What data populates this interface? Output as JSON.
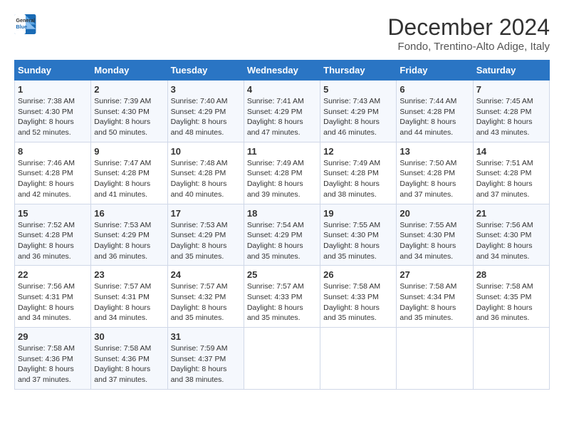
{
  "logo": {
    "line1": "General",
    "line2": "Blue"
  },
  "title": "December 2024",
  "location": "Fondo, Trentino-Alto Adige, Italy",
  "days_of_week": [
    "Sunday",
    "Monday",
    "Tuesday",
    "Wednesday",
    "Thursday",
    "Friday",
    "Saturday"
  ],
  "weeks": [
    [
      {
        "day": "1",
        "sunrise": "Sunrise: 7:38 AM",
        "sunset": "Sunset: 4:30 PM",
        "daylight": "Daylight: 8 hours and 52 minutes."
      },
      {
        "day": "2",
        "sunrise": "Sunrise: 7:39 AM",
        "sunset": "Sunset: 4:30 PM",
        "daylight": "Daylight: 8 hours and 50 minutes."
      },
      {
        "day": "3",
        "sunrise": "Sunrise: 7:40 AM",
        "sunset": "Sunset: 4:29 PM",
        "daylight": "Daylight: 8 hours and 48 minutes."
      },
      {
        "day": "4",
        "sunrise": "Sunrise: 7:41 AM",
        "sunset": "Sunset: 4:29 PM",
        "daylight": "Daylight: 8 hours and 47 minutes."
      },
      {
        "day": "5",
        "sunrise": "Sunrise: 7:43 AM",
        "sunset": "Sunset: 4:29 PM",
        "daylight": "Daylight: 8 hours and 46 minutes."
      },
      {
        "day": "6",
        "sunrise": "Sunrise: 7:44 AM",
        "sunset": "Sunset: 4:28 PM",
        "daylight": "Daylight: 8 hours and 44 minutes."
      },
      {
        "day": "7",
        "sunrise": "Sunrise: 7:45 AM",
        "sunset": "Sunset: 4:28 PM",
        "daylight": "Daylight: 8 hours and 43 minutes."
      }
    ],
    [
      {
        "day": "8",
        "sunrise": "Sunrise: 7:46 AM",
        "sunset": "Sunset: 4:28 PM",
        "daylight": "Daylight: 8 hours and 42 minutes."
      },
      {
        "day": "9",
        "sunrise": "Sunrise: 7:47 AM",
        "sunset": "Sunset: 4:28 PM",
        "daylight": "Daylight: 8 hours and 41 minutes."
      },
      {
        "day": "10",
        "sunrise": "Sunrise: 7:48 AM",
        "sunset": "Sunset: 4:28 PM",
        "daylight": "Daylight: 8 hours and 40 minutes."
      },
      {
        "day": "11",
        "sunrise": "Sunrise: 7:49 AM",
        "sunset": "Sunset: 4:28 PM",
        "daylight": "Daylight: 8 hours and 39 minutes."
      },
      {
        "day": "12",
        "sunrise": "Sunrise: 7:49 AM",
        "sunset": "Sunset: 4:28 PM",
        "daylight": "Daylight: 8 hours and 38 minutes."
      },
      {
        "day": "13",
        "sunrise": "Sunrise: 7:50 AM",
        "sunset": "Sunset: 4:28 PM",
        "daylight": "Daylight: 8 hours and 37 minutes."
      },
      {
        "day": "14",
        "sunrise": "Sunrise: 7:51 AM",
        "sunset": "Sunset: 4:28 PM",
        "daylight": "Daylight: 8 hours and 37 minutes."
      }
    ],
    [
      {
        "day": "15",
        "sunrise": "Sunrise: 7:52 AM",
        "sunset": "Sunset: 4:28 PM",
        "daylight": "Daylight: 8 hours and 36 minutes."
      },
      {
        "day": "16",
        "sunrise": "Sunrise: 7:53 AM",
        "sunset": "Sunset: 4:29 PM",
        "daylight": "Daylight: 8 hours and 36 minutes."
      },
      {
        "day": "17",
        "sunrise": "Sunrise: 7:53 AM",
        "sunset": "Sunset: 4:29 PM",
        "daylight": "Daylight: 8 hours and 35 minutes."
      },
      {
        "day": "18",
        "sunrise": "Sunrise: 7:54 AM",
        "sunset": "Sunset: 4:29 PM",
        "daylight": "Daylight: 8 hours and 35 minutes."
      },
      {
        "day": "19",
        "sunrise": "Sunrise: 7:55 AM",
        "sunset": "Sunset: 4:30 PM",
        "daylight": "Daylight: 8 hours and 35 minutes."
      },
      {
        "day": "20",
        "sunrise": "Sunrise: 7:55 AM",
        "sunset": "Sunset: 4:30 PM",
        "daylight": "Daylight: 8 hours and 34 minutes."
      },
      {
        "day": "21",
        "sunrise": "Sunrise: 7:56 AM",
        "sunset": "Sunset: 4:30 PM",
        "daylight": "Daylight: 8 hours and 34 minutes."
      }
    ],
    [
      {
        "day": "22",
        "sunrise": "Sunrise: 7:56 AM",
        "sunset": "Sunset: 4:31 PM",
        "daylight": "Daylight: 8 hours and 34 minutes."
      },
      {
        "day": "23",
        "sunrise": "Sunrise: 7:57 AM",
        "sunset": "Sunset: 4:31 PM",
        "daylight": "Daylight: 8 hours and 34 minutes."
      },
      {
        "day": "24",
        "sunrise": "Sunrise: 7:57 AM",
        "sunset": "Sunset: 4:32 PM",
        "daylight": "Daylight: 8 hours and 35 minutes."
      },
      {
        "day": "25",
        "sunrise": "Sunrise: 7:57 AM",
        "sunset": "Sunset: 4:33 PM",
        "daylight": "Daylight: 8 hours and 35 minutes."
      },
      {
        "day": "26",
        "sunrise": "Sunrise: 7:58 AM",
        "sunset": "Sunset: 4:33 PM",
        "daylight": "Daylight: 8 hours and 35 minutes."
      },
      {
        "day": "27",
        "sunrise": "Sunrise: 7:58 AM",
        "sunset": "Sunset: 4:34 PM",
        "daylight": "Daylight: 8 hours and 35 minutes."
      },
      {
        "day": "28",
        "sunrise": "Sunrise: 7:58 AM",
        "sunset": "Sunset: 4:35 PM",
        "daylight": "Daylight: 8 hours and 36 minutes."
      }
    ],
    [
      {
        "day": "29",
        "sunrise": "Sunrise: 7:58 AM",
        "sunset": "Sunset: 4:36 PM",
        "daylight": "Daylight: 8 hours and 37 minutes."
      },
      {
        "day": "30",
        "sunrise": "Sunrise: 7:58 AM",
        "sunset": "Sunset: 4:36 PM",
        "daylight": "Daylight: 8 hours and 37 minutes."
      },
      {
        "day": "31",
        "sunrise": "Sunrise: 7:59 AM",
        "sunset": "Sunset: 4:37 PM",
        "daylight": "Daylight: 8 hours and 38 minutes."
      },
      null,
      null,
      null,
      null
    ]
  ]
}
